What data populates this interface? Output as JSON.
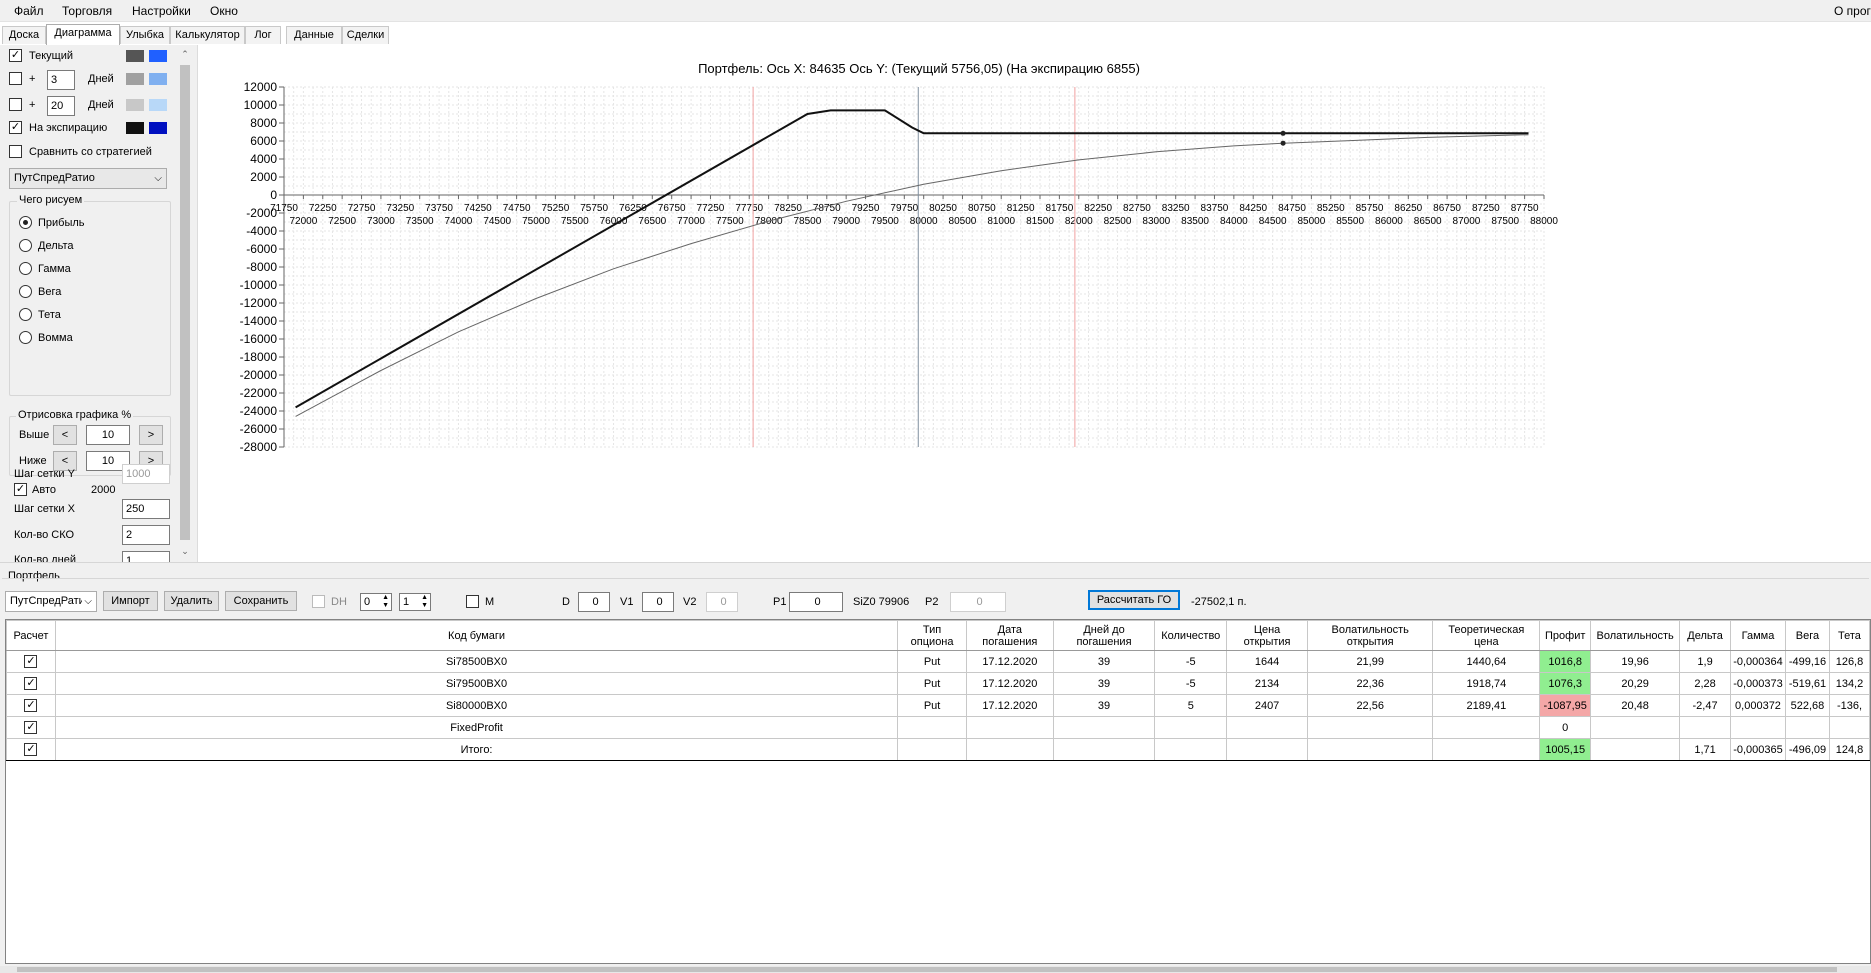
{
  "menu": [
    "Файл",
    "Торговля",
    "Настройки",
    "Окно"
  ],
  "menu_right": "О прог",
  "tabs": [
    "Доска",
    "Диаграмма",
    "Улыбка",
    "Калькулятор",
    "Лог",
    "Данные",
    "Сделки"
  ],
  "left": {
    "current_label": "Текущий",
    "plus": "+",
    "days_label": "Дней",
    "days1": "3",
    "days2": "20",
    "expiry_label": "На экспирацию",
    "compare_label": "Сравнить со стратегией",
    "strategy": "ПутСпредРатио",
    "draw_group": "Чего рисуем",
    "draw_options": [
      "Прибыль",
      "Дельта",
      "Гамма",
      "Вега",
      "Тета",
      "Вомма"
    ],
    "render_group": "Отрисовка графика %",
    "above_label": "Выше",
    "below_label": "Ниже",
    "above_val": "10",
    "below_val": "10",
    "lt": "<",
    "gt": ">",
    "grid_y_label": "Шаг сетки Y",
    "grid_y_val": "1000",
    "auto_label": "Авто",
    "auto_val": "2000",
    "grid_x_label": "Шаг сетки X",
    "grid_x_val": "250",
    "sko_label": "Кол-во СКО",
    "sko_val": "2",
    "days_count_label": "Кол-во дней",
    "days_count_val": "1",
    "colors": {
      "current": [
        "#555555",
        "#2060ff"
      ],
      "d3": [
        "#a0a0a0",
        "#80b0f0"
      ],
      "d20": [
        "#c8c8c8",
        "#b8d8f8"
      ],
      "expiry": [
        "#111111",
        "#0010c0"
      ]
    }
  },
  "chart_data": {
    "type": "line",
    "title": "Портфель: Ось X: 84635 Ось Y:  (Текущий 5756,05)  (На экспирацию 6855)",
    "x_range": [
      71750,
      88000
    ],
    "y_range": [
      -28000,
      12000
    ],
    "y_ticks": [
      12000,
      10000,
      8000,
      6000,
      4000,
      2000,
      0,
      -2000,
      -4000,
      -6000,
      -8000,
      -10000,
      -12000,
      -14000,
      -16000,
      -18000,
      -20000,
      -22000,
      -24000,
      -26000,
      -28000
    ],
    "x_ticks_upper": [
      71750,
      72250,
      72750,
      73250,
      73750,
      74250,
      74750,
      75250,
      75750,
      76250,
      76750,
      77250,
      77750,
      78250,
      78750,
      79250,
      79750,
      80250,
      80750,
      81250,
      81750,
      82250,
      82750,
      83250,
      83750,
      84250,
      84750,
      85250,
      85750,
      86250,
      86750,
      87250,
      87750
    ],
    "x_ticks_lower": [
      72000,
      72500,
      73000,
      73500,
      74000,
      74500,
      75000,
      75500,
      76000,
      76500,
      77000,
      77500,
      78000,
      78500,
      79000,
      79500,
      80000,
      80500,
      81000,
      81500,
      82000,
      82500,
      83000,
      83500,
      84000,
      84500,
      85000,
      85500,
      86000,
      86500,
      87000,
      87500,
      88000
    ],
    "grid": true,
    "vlines": [
      {
        "x": 77800,
        "color": "#f0a0a0"
      },
      {
        "x": 79930,
        "color": "#8090a0"
      },
      {
        "x": 81950,
        "color": "#f0a0a0"
      }
    ],
    "series": [
      {
        "color": "#111111",
        "width": 2,
        "points": [
          [
            71900,
            -23600
          ],
          [
            78500,
            9000
          ],
          [
            78800,
            9400
          ],
          [
            79500,
            9400
          ],
          [
            79850,
            7500
          ],
          [
            80000,
            6855
          ],
          [
            82000,
            6855
          ],
          [
            84635,
            6855
          ],
          [
            87800,
            6855
          ]
        ]
      },
      {
        "color": "#666666",
        "width": 1,
        "points": [
          [
            71900,
            -24600
          ],
          [
            73000,
            -19500
          ],
          [
            74000,
            -15200
          ],
          [
            75000,
            -11500
          ],
          [
            76000,
            -8200
          ],
          [
            77000,
            -5400
          ],
          [
            78000,
            -2900
          ],
          [
            79000,
            -700
          ],
          [
            80000,
            1200
          ],
          [
            81000,
            2700
          ],
          [
            82000,
            3900
          ],
          [
            83000,
            4800
          ],
          [
            84000,
            5450
          ],
          [
            84635,
            5756
          ],
          [
            85500,
            6050
          ],
          [
            86500,
            6400
          ],
          [
            87800,
            6700
          ]
        ]
      }
    ],
    "markers": [
      {
        "x": 84635,
        "y": 6855
      },
      {
        "x": 84635,
        "y": 5756
      }
    ]
  },
  "portfolio": {
    "label": "Портфель",
    "strategy": "ПутСпредРатио",
    "btn_import": "Импорт",
    "btn_delete": "Удалить",
    "btn_save": "Сохранить",
    "dh_label": "DH",
    "dh_v1": "0",
    "dh_v2": "1",
    "m_label": "M",
    "d_label": "D",
    "d_val": "0",
    "v1_label": "V1",
    "v1_val": "0",
    "v2_label": "V2",
    "v2_val": "0",
    "p1_label": "P1",
    "p1_val": "0",
    "siz_label": "SiZ0 79906",
    "p2_label": "P2",
    "p2_val": "0",
    "btn_calc": "Рассчитать ГО",
    "go_value": "-27502,1 п."
  },
  "table": {
    "headers": [
      "Расчет",
      "Код бумаги",
      "Тип опциона",
      "Дата погашения",
      "Дней до погашения",
      "Количество",
      "Цена открытия",
      "Волатильность открытия",
      "Теоретическая цена",
      "Профит",
      "Волатильность",
      "Дельта",
      "Гамма",
      "Вега",
      "Тета"
    ],
    "rows": [
      {
        "code": "Si78500BX0",
        "type": "Put",
        "date": "17.12.2020",
        "days": "39",
        "qty": "-5",
        "open": "1644",
        "vol_open": "21,99",
        "theo": "1440,64",
        "profit": "1016,8",
        "profit_state": "green",
        "vol": "19,96",
        "delta": "1,9",
        "gamma": "-0,000364",
        "vega": "-499,16",
        "theta": "126,8"
      },
      {
        "code": "Si79500BX0",
        "type": "Put",
        "date": "17.12.2020",
        "days": "39",
        "qty": "-5",
        "open": "2134",
        "vol_open": "22,36",
        "theo": "1918,74",
        "profit": "1076,3",
        "profit_state": "green",
        "vol": "20,29",
        "delta": "2,28",
        "gamma": "-0,000373",
        "vega": "-519,61",
        "theta": "134,2"
      },
      {
        "code": "Si80000BX0",
        "type": "Put",
        "date": "17.12.2020",
        "days": "39",
        "qty": "5",
        "open": "2407",
        "vol_open": "22,56",
        "theo": "2189,41",
        "profit": "-1087,95",
        "profit_state": "red",
        "vol": "20,48",
        "delta": "-2,47",
        "gamma": "0,000372",
        "vega": "522,68",
        "theta": "-136,"
      },
      {
        "code": "FixedProfit",
        "type": "",
        "date": "",
        "days": "",
        "qty": "",
        "open": "",
        "vol_open": "",
        "theo": "",
        "profit": "0",
        "profit_state": "",
        "vol": "",
        "delta": "",
        "gamma": "",
        "vega": "",
        "theta": ""
      },
      {
        "code": "Итого:",
        "type": "",
        "date": "",
        "days": "",
        "qty": "",
        "open": "",
        "vol_open": "",
        "theo": "",
        "profit": "1005,15",
        "profit_state": "green",
        "vol": "",
        "delta": "1,71",
        "gamma": "-0,000365",
        "vega": "-496,09",
        "theta": "124,8"
      }
    ]
  }
}
